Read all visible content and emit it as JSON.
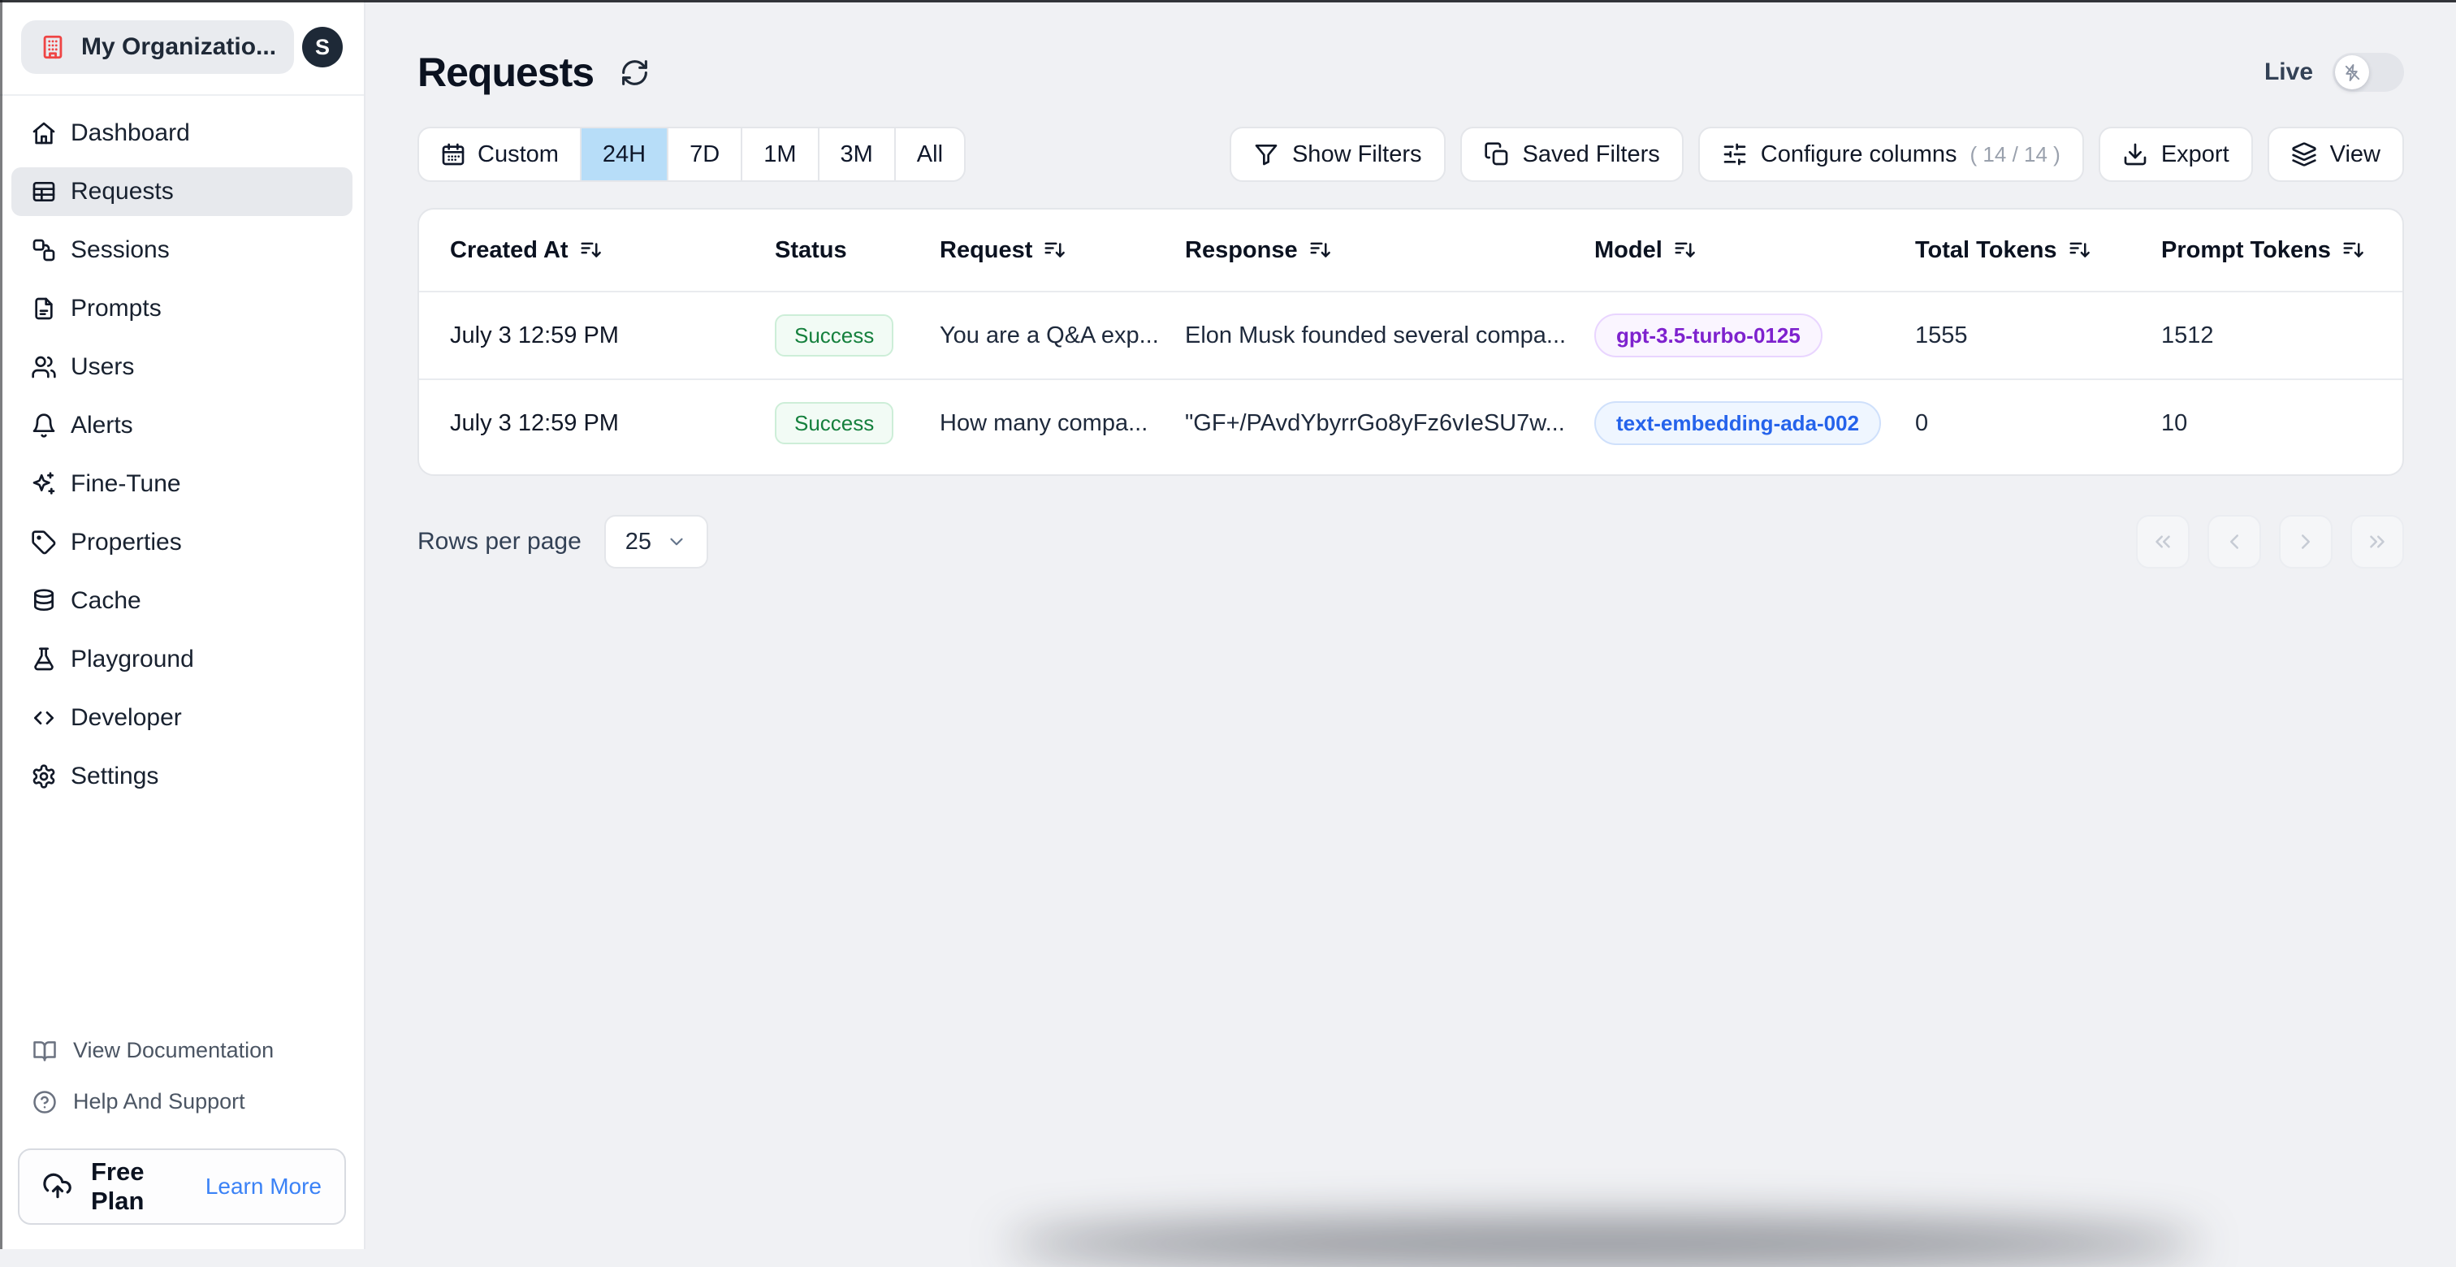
{
  "org_switcher": {
    "name": "My Organizatio...",
    "icon": "building"
  },
  "user": {
    "initial": "S"
  },
  "sidebar": {
    "items": [
      {
        "label": "Dashboard",
        "icon": "home",
        "active": false
      },
      {
        "label": "Requests",
        "icon": "table",
        "active": true
      },
      {
        "label": "Sessions",
        "icon": "sessions",
        "active": false
      },
      {
        "label": "Prompts",
        "icon": "file",
        "active": false
      },
      {
        "label": "Users",
        "icon": "users",
        "active": false
      },
      {
        "label": "Alerts",
        "icon": "bell",
        "active": false
      },
      {
        "label": "Fine-Tune",
        "icon": "sparkles",
        "active": false
      },
      {
        "label": "Properties",
        "icon": "tag",
        "active": false
      },
      {
        "label": "Cache",
        "icon": "database",
        "active": false
      },
      {
        "label": "Playground",
        "icon": "flask",
        "active": false
      },
      {
        "label": "Developer",
        "icon": "code",
        "active": false
      },
      {
        "label": "Settings",
        "icon": "gear",
        "active": false
      }
    ],
    "footer_links": [
      {
        "label": "View Documentation",
        "icon": "book"
      },
      {
        "label": "Help And Support",
        "icon": "help"
      }
    ],
    "plan": {
      "label": "Free Plan",
      "cta": "Learn More",
      "icon": "cloud-up"
    }
  },
  "page": {
    "title": "Requests",
    "live": {
      "label": "Live",
      "enabled": false
    }
  },
  "toolbar": {
    "time_ranges": [
      {
        "label": "Custom",
        "icon": "calendar",
        "selected": false
      },
      {
        "label": "24H",
        "selected": true
      },
      {
        "label": "7D",
        "selected": false
      },
      {
        "label": "1M",
        "selected": false
      },
      {
        "label": "3M",
        "selected": false
      },
      {
        "label": "All",
        "selected": false
      }
    ],
    "actions": [
      {
        "label": "Show Filters",
        "icon": "funnel"
      },
      {
        "label": "Saved Filters",
        "icon": "copy"
      },
      {
        "label": "Configure columns",
        "icon": "sliders",
        "suffix": "( 14 / 14 )"
      },
      {
        "label": "Export",
        "icon": "download"
      },
      {
        "label": "View",
        "icon": "layers"
      }
    ]
  },
  "table": {
    "columns": [
      {
        "label": "Created At",
        "sortable": true
      },
      {
        "label": "Status",
        "sortable": false
      },
      {
        "label": "Request",
        "sortable": true
      },
      {
        "label": "Response",
        "sortable": true
      },
      {
        "label": "Model",
        "sortable": true
      },
      {
        "label": "Total Tokens",
        "sortable": true
      },
      {
        "label": "Prompt Tokens",
        "sortable": true
      }
    ],
    "rows": [
      {
        "created_at": "July 3 12:59 PM",
        "status": "Success",
        "request": "You are a Q&A exp...",
        "response": "Elon Musk founded several compa...",
        "model": "gpt-3.5-turbo-0125",
        "model_color": "purple",
        "total_tokens": "1555",
        "prompt_tokens": "1512"
      },
      {
        "created_at": "July 3 12:59 PM",
        "status": "Success",
        "request": "How many compa...",
        "response": "\"GF+/PAvdYbyrrGo8yFz6vIeSU7w...",
        "model": "text-embedding-ada-002",
        "model_color": "blue",
        "total_tokens": "0",
        "prompt_tokens": "10"
      }
    ]
  },
  "pagination": {
    "rows_per_page_label": "Rows per page",
    "page_size": "25",
    "pager": [
      {
        "name": "first-page",
        "icon": "chevrons-left"
      },
      {
        "name": "previous-page",
        "icon": "chevron-left"
      },
      {
        "name": "next-page",
        "icon": "chevron-right"
      },
      {
        "name": "last-page",
        "icon": "chevrons-right"
      }
    ]
  },
  "colors": {
    "accent-selected": "#b7ddf8",
    "success-text": "#15803d",
    "success-bg": "#f2fbf5",
    "success-border": "#cdeed8",
    "model-purple-text": "#7e22ce",
    "model-purple-bg": "#faf5ff",
    "model-purple-border": "#e9d5ff",
    "model-blue-text": "#2563eb",
    "model-blue-bg": "#eff6ff",
    "model-blue-border": "#cfe0fb",
    "link-blue": "#3b82f6",
    "org-icon-red": "#ef4444",
    "avatar-bg": "#1e2937"
  }
}
